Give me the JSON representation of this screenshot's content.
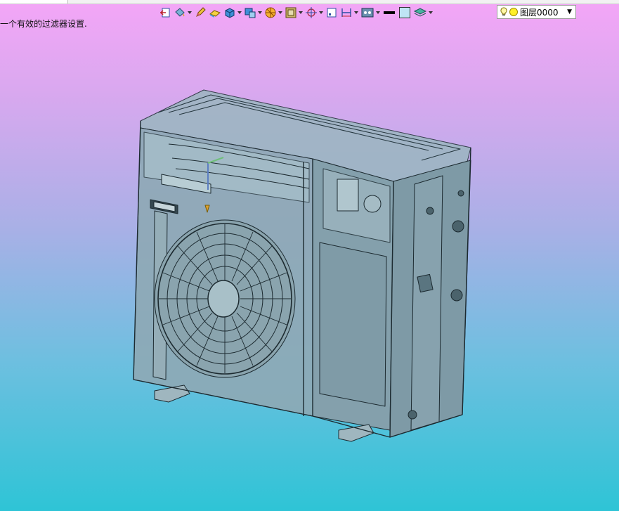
{
  "status_message": "一个有效的过滤器设置.",
  "layer": {
    "name": "图层0000",
    "bulb_icon": "light-bulb-icon",
    "color_icon": "layer-color-icon",
    "bulb_color": "#fff7a8",
    "layer_color": "#ffef2a"
  },
  "toolbar": [
    {
      "name": "exit-sketch-icon",
      "dropdown": false
    },
    {
      "name": "paint-bucket-icon",
      "dropdown": true
    },
    {
      "name": "pencil-icon",
      "dropdown": false
    },
    {
      "name": "eraser-icon",
      "dropdown": false
    },
    {
      "name": "solid-box-icon",
      "dropdown": true
    },
    {
      "name": "view-orient-icon",
      "dropdown": true
    },
    {
      "name": "render-style-icon",
      "dropdown": true
    },
    {
      "name": "section-view-icon",
      "dropdown": true
    },
    {
      "name": "snap-target-icon",
      "dropdown": true
    },
    {
      "name": "frame-icon",
      "dropdown": false
    },
    {
      "name": "dimension-icon",
      "dropdown": true
    },
    {
      "name": "display-filter-icon",
      "dropdown": true
    },
    {
      "name": "line-style-icon",
      "dropdown": false
    },
    {
      "name": "color-swatch-icon",
      "dropdown": false
    },
    {
      "name": "layers-icon",
      "dropdown": true
    }
  ],
  "colors": {
    "background_top": "#f4a6f7",
    "background_bottom": "#2ec4d6",
    "model_fill": "#8aa7b4",
    "model_edge": "#1c2a30"
  },
  "viewport": {
    "model": "outdoor-unit-3d-model"
  }
}
